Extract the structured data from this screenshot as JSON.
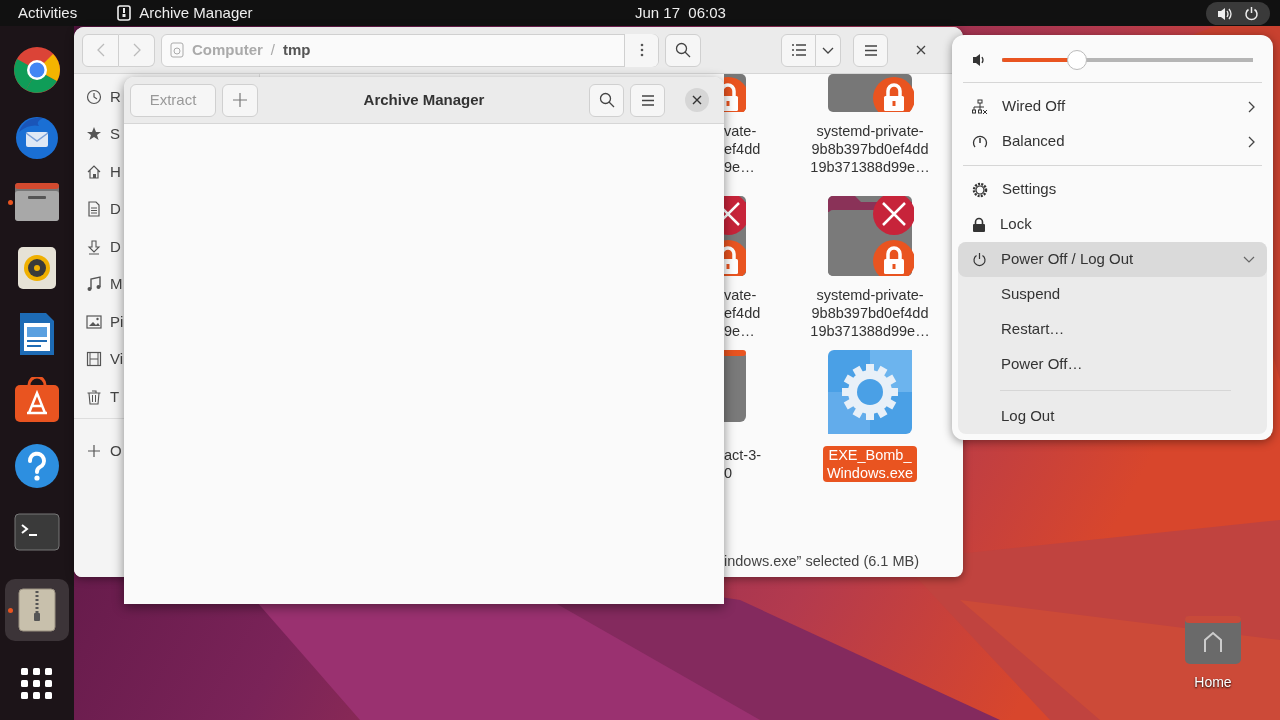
{
  "top_bar": {
    "activities": "Activities",
    "app_name": "Archive Manager",
    "clock": "Jun 17  06:03"
  },
  "dock": [
    {
      "kind": "browser",
      "running": false,
      "selected": false
    },
    {
      "kind": "mail",
      "running": false,
      "selected": false
    },
    {
      "kind": "files",
      "running": true,
      "selected": false
    },
    {
      "kind": "music",
      "running": false,
      "selected": false
    },
    {
      "kind": "writer",
      "running": false,
      "selected": false
    },
    {
      "kind": "store",
      "running": false,
      "selected": false
    },
    {
      "kind": "help",
      "running": false,
      "selected": false
    },
    {
      "kind": "terminal",
      "running": false,
      "selected": false
    },
    {
      "kind": "archive",
      "running": true,
      "selected": true
    },
    {
      "kind": "apps",
      "running": false,
      "selected": false
    }
  ],
  "files_window": {
    "path": [
      "Computer",
      "tmp"
    ],
    "path_separator": "/",
    "sidebar": [
      {
        "kind": "recent",
        "label": "R"
      },
      {
        "kind": "starred",
        "label": "S"
      },
      {
        "kind": "home",
        "label": "H"
      },
      {
        "kind": "documents",
        "label": "D"
      },
      {
        "kind": "downloads",
        "label": "D"
      },
      {
        "kind": "music",
        "label": "M"
      },
      {
        "kind": "pictures",
        "label": "Pi"
      },
      {
        "kind": "videos",
        "label": "Vi"
      },
      {
        "kind": "trash",
        "label": "T"
      },
      {
        "kind": "other",
        "label": "O"
      }
    ],
    "partial_column": [
      {
        "kind": "locked",
        "lines": [
          "vate-",
          "ef4dd",
          "9e…"
        ]
      },
      {
        "kind": "locked_error",
        "lines": [
          "vate-",
          "ef4dd",
          "9e…"
        ]
      },
      {
        "kind": "folder",
        "lines": [
          "act-3-",
          "0"
        ]
      }
    ],
    "items": [
      {
        "kind": "locked",
        "lines": [
          "systemd-private-",
          "9b8b397bd0ef4dd",
          "19b371388d99e…"
        ],
        "selected": false
      },
      {
        "kind": "locked_error",
        "lines": [
          "systemd-private-",
          "9b8b397bd0ef4dd",
          "19b371388d99e…"
        ],
        "selected": false
      },
      {
        "kind": "executable",
        "lines": [
          "EXE_Bomb_",
          "Windows.exe"
        ],
        "selected": true
      }
    ],
    "status": "indows.exe” selected (6.1 MB)"
  },
  "archive_window": {
    "title": "Archive Manager",
    "extract": {
      "label": "Extract",
      "disabled": true
    }
  },
  "quick_settings": {
    "volume": {
      "level": 0.3
    },
    "rows": [
      {
        "kind": "network",
        "label": "Wired Off",
        "submenu": true
      },
      {
        "kind": "power_mode",
        "label": "Balanced",
        "submenu": true
      },
      {
        "kind": "divider"
      },
      {
        "kind": "settings",
        "label": "Settings",
        "submenu": false
      },
      {
        "kind": "lock",
        "label": "Lock",
        "submenu": false
      },
      {
        "kind": "power",
        "label": "Power Off / Log Out",
        "submenu": false,
        "expanded": true,
        "children": [
          {
            "kind": "item",
            "label": "Suspend"
          },
          {
            "kind": "item",
            "label": "Restart…"
          },
          {
            "kind": "item",
            "label": "Power Off…"
          },
          {
            "kind": "divider"
          },
          {
            "kind": "item",
            "label": "Log Out"
          }
        ]
      }
    ]
  },
  "desktop": {
    "home_label": "Home"
  }
}
